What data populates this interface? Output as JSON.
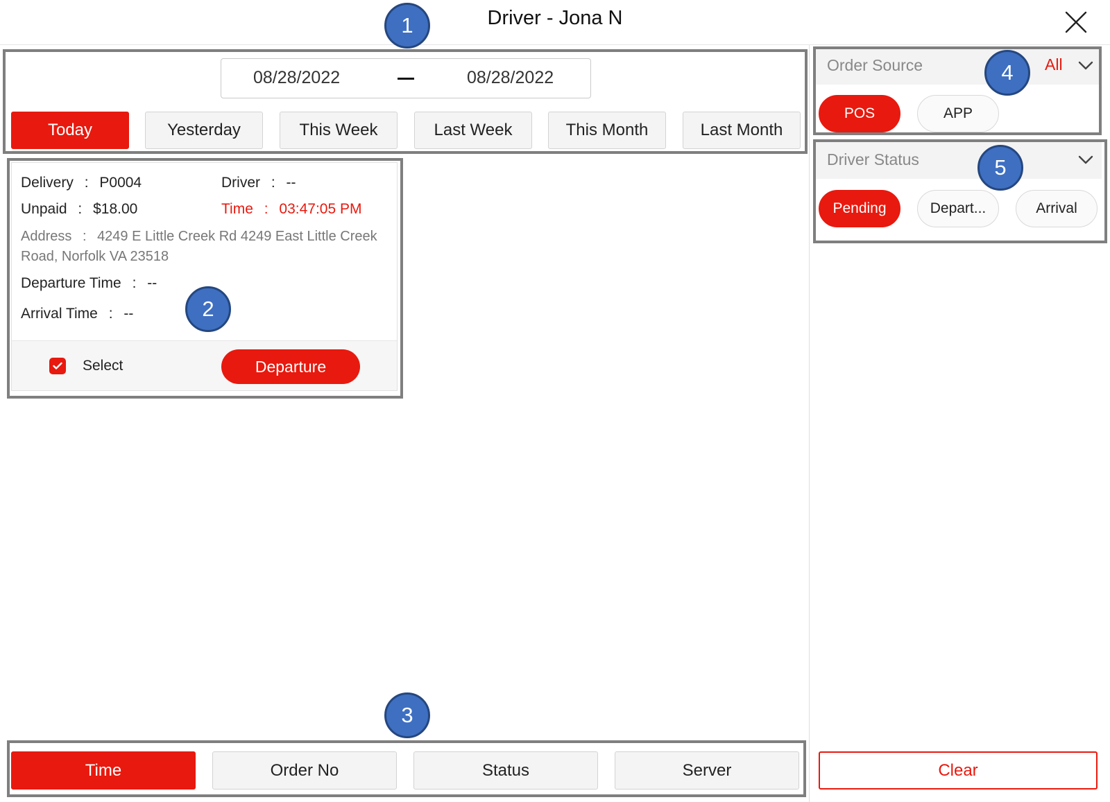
{
  "header": {
    "title": "Driver - Jona N",
    "close_icon": "close-icon"
  },
  "annotations": [
    "1",
    "2",
    "3",
    "4",
    "5"
  ],
  "date_range": {
    "start": "08/28/2022",
    "end": "08/28/2022"
  },
  "period_buttons": [
    {
      "label": "Today",
      "active": true
    },
    {
      "label": "Yesterday",
      "active": false
    },
    {
      "label": "This Week",
      "active": false
    },
    {
      "label": "Last Week",
      "active": false
    },
    {
      "label": "This Month",
      "active": false
    },
    {
      "label": "Last Month",
      "active": false
    }
  ],
  "card": {
    "delivery_label": "Delivery",
    "delivery_value": "P0004",
    "driver_label": "Driver",
    "driver_value": "--",
    "unpaid_label": "Unpaid",
    "unpaid_value": "$18.00",
    "time_label": "Time",
    "time_value": "03:47:05 PM",
    "address_label": "Address",
    "address_line1": "4249 E Little Creek Rd 4249 East Little Creek",
    "address_line2": "Road, Norfolk VA 23518",
    "departure_time_label": "Departure Time",
    "departure_time_value": "--",
    "arrival_time_label": "Arrival Time",
    "arrival_time_value": "--",
    "separator": ":",
    "select_label": "Select",
    "select_checked": true,
    "departure_button": "Departure"
  },
  "sort_buttons": [
    {
      "label": "Time",
      "active": true
    },
    {
      "label": "Order No",
      "active": false
    },
    {
      "label": "Status",
      "active": false
    },
    {
      "label": "Server",
      "active": false
    }
  ],
  "order_source": {
    "title": "Order Source",
    "selected": "All",
    "options": [
      {
        "label": "POS",
        "active": true
      },
      {
        "label": "APP",
        "active": false
      }
    ]
  },
  "driver_status": {
    "title": "Driver Status",
    "options": [
      {
        "label": "Pending",
        "active": true
      },
      {
        "label": "Depart...",
        "active": false
      },
      {
        "label": "Arrival",
        "active": false
      }
    ]
  },
  "clear_button": "Clear",
  "colors": {
    "accent": "#e8190e",
    "badge": "#3e6fc1",
    "annotation_border": "#7f7f7f"
  }
}
